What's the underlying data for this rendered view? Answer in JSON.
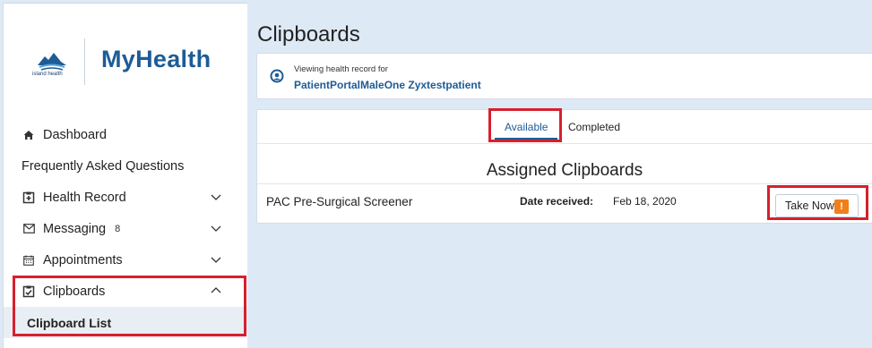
{
  "brand": {
    "name": "MyHealth",
    "logo_text": "island health"
  },
  "nav": {
    "dashboard": "Dashboard",
    "faq": "Frequently Asked Questions",
    "health_record": "Health Record",
    "messaging": "Messaging",
    "messaging_count": "8",
    "appointments": "Appointments",
    "clipboards": "Clipboards",
    "clipboard_list": "Clipboard List"
  },
  "page": {
    "title": "Clipboards"
  },
  "patient": {
    "caption": "Viewing health record for",
    "name": "PatientPortalMaleOne Zyxtestpatient"
  },
  "tabs": {
    "available": "Available",
    "completed": "Completed"
  },
  "section": {
    "title": "Assigned Clipboards"
  },
  "clipboards": [
    {
      "name": "PAC Pre-Surgical Screener",
      "date_label": "Date received:",
      "date": "Feb 18, 2020",
      "action": "Take Now",
      "warning": "!"
    }
  ],
  "colors": {
    "brand_blue": "#1d5c96",
    "highlight_red": "#d6202e",
    "warning_orange": "#f07f1a",
    "page_bg": "#dde9f5"
  }
}
